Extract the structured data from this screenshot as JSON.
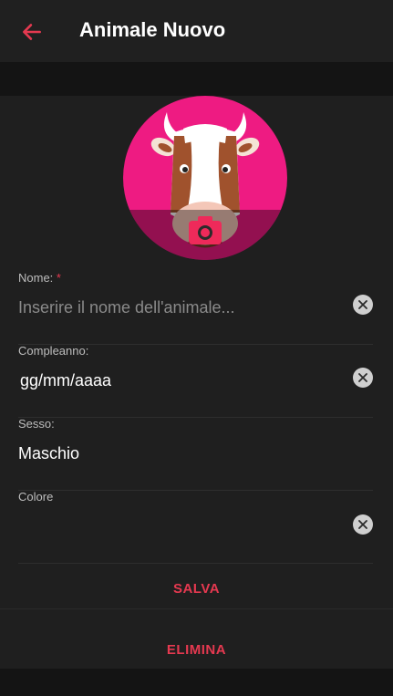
{
  "appbar": {
    "title": "Animale Nuovo",
    "back_icon": "arrow-left-icon"
  },
  "avatar": {
    "icon": "camera-icon",
    "bg_color": "#ee1b82"
  },
  "fields": {
    "name": {
      "label": "Nome:",
      "required_mark": "*",
      "placeholder": "Inserire il nome dell'animale...",
      "value": ""
    },
    "birthday": {
      "label": "Compleanno:",
      "value": "gg/mm/aaaa"
    },
    "sex": {
      "label": "Sesso:",
      "value": "Maschio"
    },
    "color": {
      "label": "Colore",
      "value": ""
    }
  },
  "actions": {
    "save_label": "SALVA",
    "delete_label": "ELIMINA"
  },
  "colors": {
    "accent": "#e53950",
    "background": "#1f1f1f",
    "appbar": "#202020"
  }
}
